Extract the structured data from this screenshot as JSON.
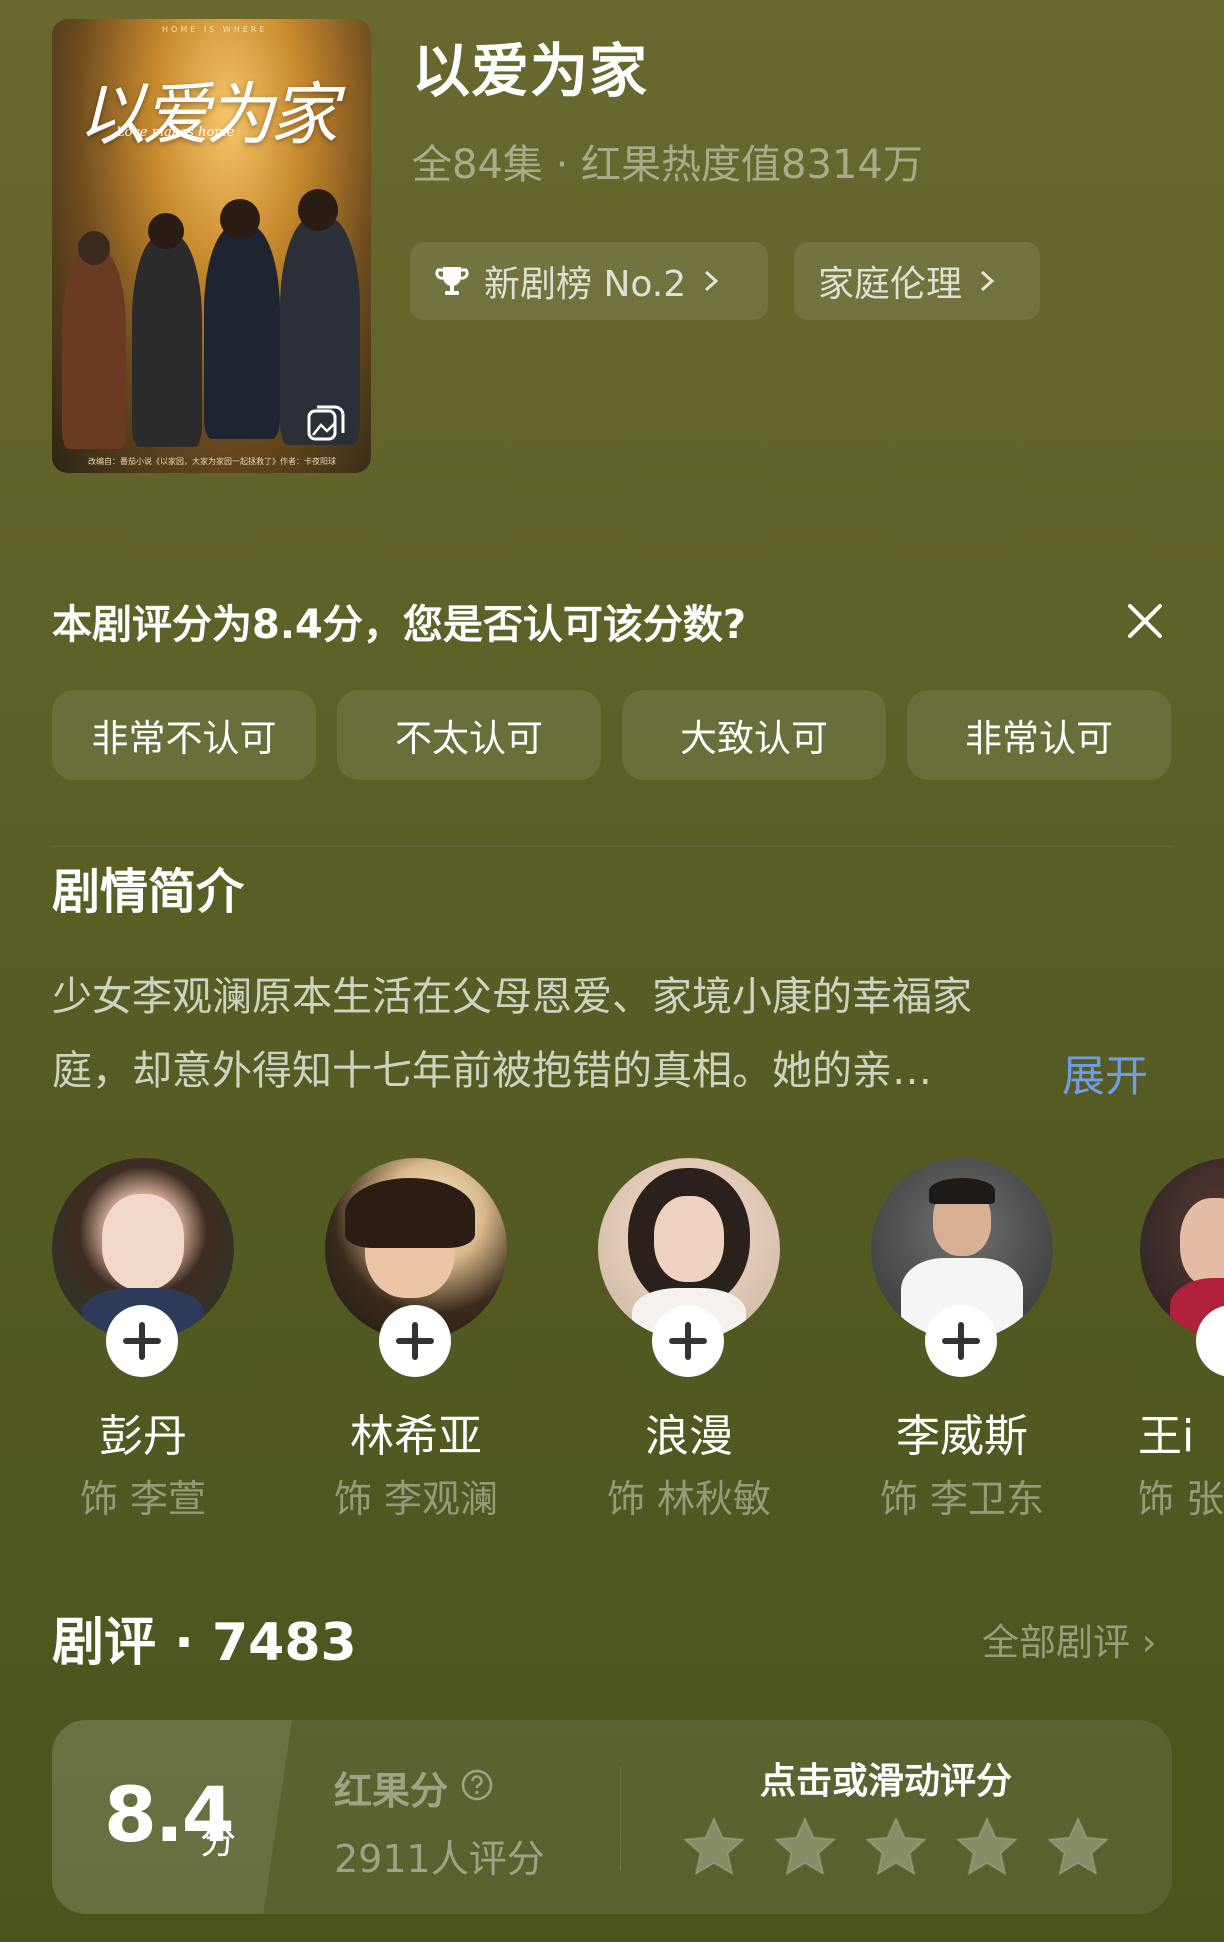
{
  "show": {
    "title": "以爱为家",
    "meta": "全84集 · 红果热度值8314万",
    "poster_title_art": "以爱为家",
    "poster_subtitle_art": "Love makes home",
    "poster_top_caption": "HOME IS WHERE",
    "poster_bottom_caption": "改编自：番茄小说《以家园，大家为家园一起拯救了》作者：卡夜阳球"
  },
  "chips": [
    {
      "label": "新剧榜 No.2",
      "icon": "trophy-icon"
    },
    {
      "label": "家庭伦理"
    }
  ],
  "rating_question": {
    "text": "本剧评分为8.4分，您是否认可该分数?",
    "options": [
      "非常不认可",
      "不太认可",
      "大致认可",
      "非常认可"
    ]
  },
  "synopsis": {
    "title": "剧情简介",
    "text_line1": "少女李观澜原本生活在父母恩爱、家境小康的幸福家",
    "text_line2": "庭，却意外得知十七年前被抱错的真相。她的亲…",
    "expand": "展开"
  },
  "cast": [
    {
      "name": "彭丹",
      "role": "饰 李萱"
    },
    {
      "name": "林希亚",
      "role": "饰 李观澜"
    },
    {
      "name": "浪漫",
      "role": "饰 林秋敏"
    },
    {
      "name": "李威斯",
      "role": "饰 李卫东"
    },
    {
      "name": "王i",
      "role": "饰 张"
    }
  ],
  "reviews": {
    "title": "剧评 · 7483",
    "all_link": "全部剧评 ›",
    "score": "8.4",
    "score_unit": "分",
    "score_label": "红果分",
    "rating_count": "2911人评分",
    "rate_prompt": "点击或滑动评分",
    "star_count": 5
  },
  "colors": {
    "background": "#5f6228",
    "link_blue": "#6f9ee8"
  }
}
